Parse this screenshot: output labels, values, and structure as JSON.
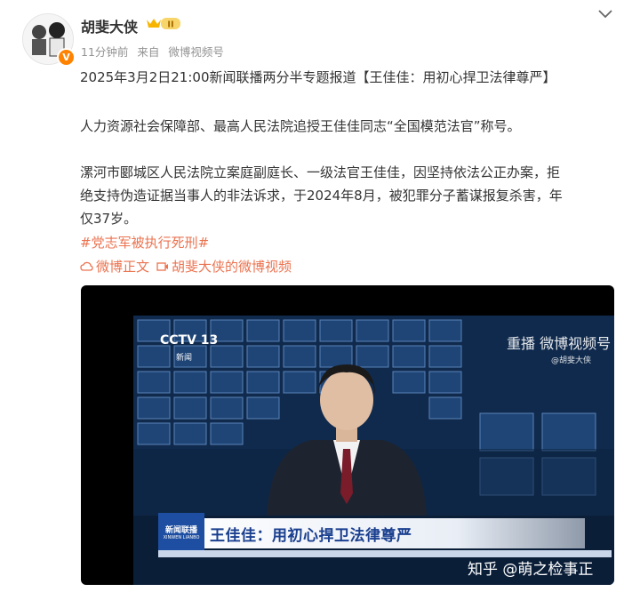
{
  "post": {
    "username": "胡斐大侠",
    "vip_level": "II",
    "time": "11分钟前",
    "source_prefix": "来自",
    "source": "微博视频号",
    "verified_mark": "V",
    "line1": "2025年3月2日21:00新闻联播两分半专题报道【王佳佳：用初心捍卫法律尊严】",
    "line2": "人力资源社会保障部、最高人民法院追授王佳佳同志“全国模范法官”称号。",
    "line3a": "漯河市郾城区人民法院立案庭副庭长、一级法官王佳佳，因坚持依法公正办案，拒",
    "line3b": "绝支持伪造证据当事人的非法诉求，于2024年8月，被犯罪分子蓄谋报复杀害，年",
    "line3c": "仅37岁。",
    "hashtag": "#党志军被执行死刑#",
    "link1": "微博正文",
    "link2": "胡斐大侠的微博视频"
  },
  "video": {
    "channel_logo": "CCTV 13",
    "channel_sub": "新闻",
    "watermark_top": "重播",
    "watermark": "微博视频号",
    "watermark_user": "@胡斐大侠",
    "banner_logo_line1": "新闻联播",
    "banner_logo_line2": "XINWEN LIANBO",
    "banner_title": "王佳佳：用初心捍卫法律尊严"
  },
  "footer": {
    "zhihu_watermark": "知乎 @萌之检事正"
  },
  "colors": {
    "accent_orange": "#eb7350",
    "meta_gray": "#939393",
    "banner_blue": "#1a3f8f"
  }
}
